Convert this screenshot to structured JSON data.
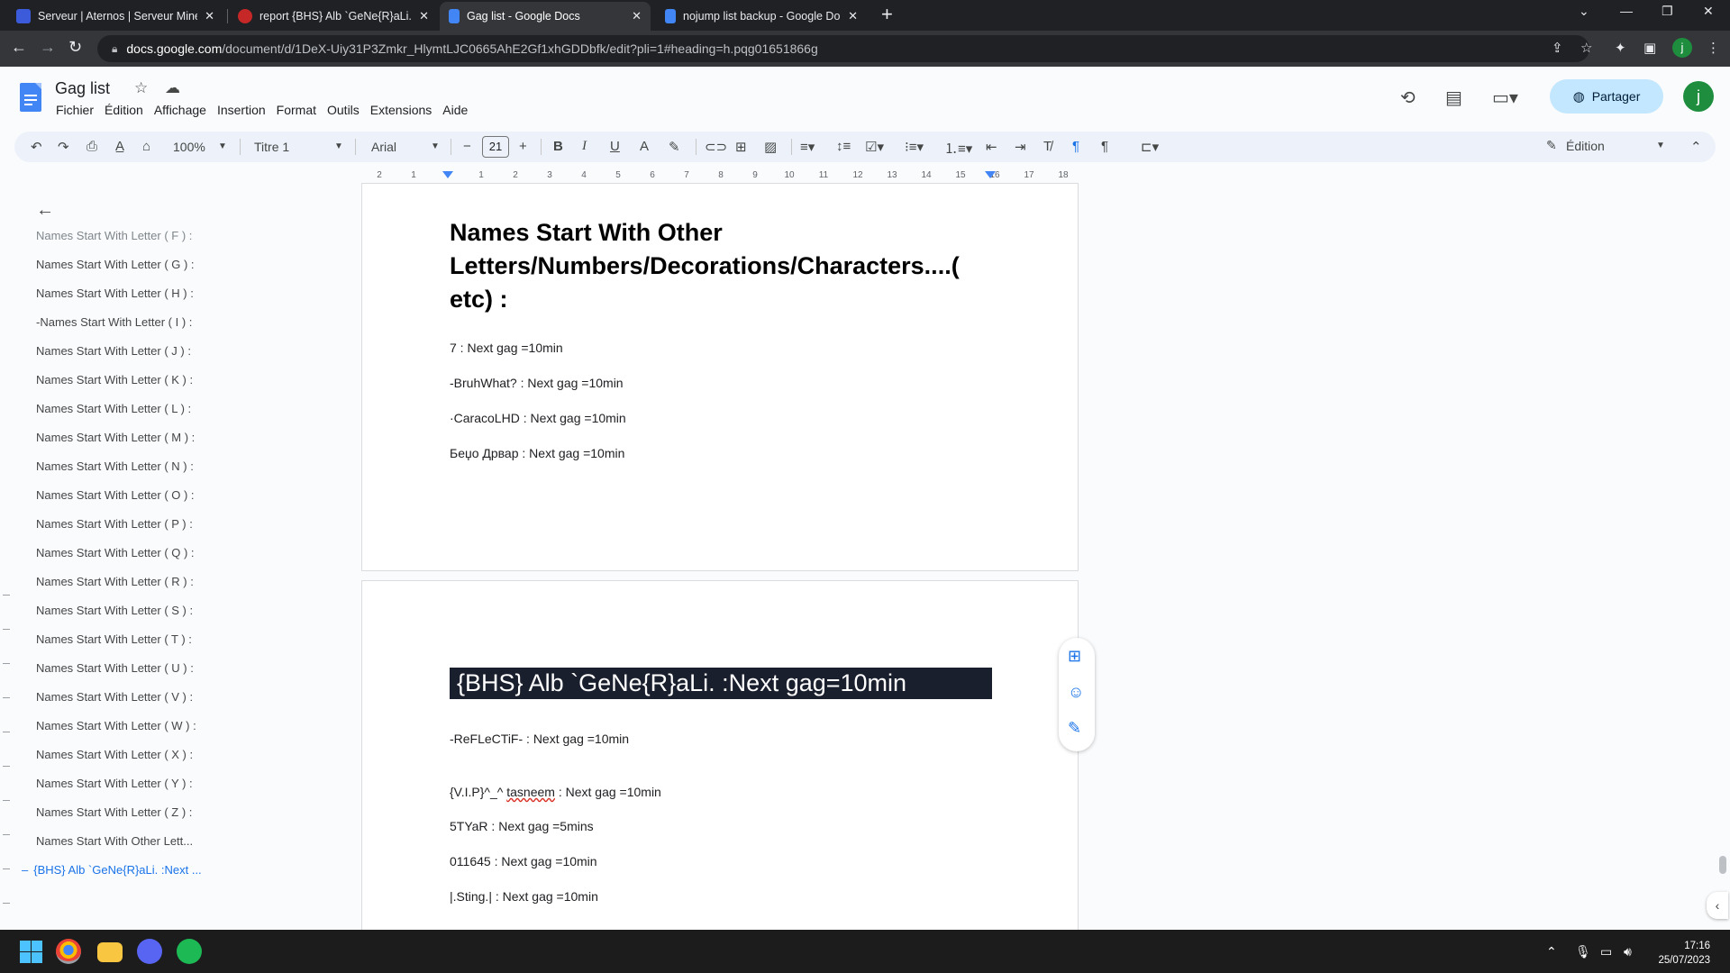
{
  "browser": {
    "tabs": [
      {
        "title": "Serveur | Aternos | Serveur Mine",
        "active": false,
        "icon": "aternos-icon"
      },
      {
        "title": "report {BHS} Alb `GeNe{R}aLi. - P",
        "active": false,
        "icon": "forum-icon"
      },
      {
        "title": "Gag list - Google Docs",
        "active": true,
        "icon": "docs-icon"
      },
      {
        "title": "nojump list backup - Google Do",
        "active": false,
        "icon": "docs-icon"
      }
    ],
    "url_domain": "docs.google.com",
    "url_path": "/document/d/1DeX-Uiy31P3Zmkr_HlymtLJC0665AhE2Gf1xhGDDbfk/edit?pli=1#heading=h.pqg01651866g",
    "profile_initial": "j"
  },
  "docs": {
    "title": "Gag list",
    "menu": [
      "Fichier",
      "Édition",
      "Affichage",
      "Insertion",
      "Format",
      "Outils",
      "Extensions",
      "Aide"
    ],
    "share_label": "Partager",
    "user_initial": "j"
  },
  "toolbar": {
    "zoom": "100%",
    "style": "Titre 1",
    "font": "Arial",
    "font_size": "21",
    "mode": "Édition"
  },
  "ruler": {
    "numbers": [
      "2",
      "1",
      "1",
      "2",
      "3",
      "4",
      "5",
      "6",
      "7",
      "8",
      "9",
      "10",
      "11",
      "12",
      "13",
      "14",
      "15",
      "16",
      "17",
      "18"
    ]
  },
  "outline": {
    "items": [
      "Names Start With Letter ( F ) :",
      "Names Start With Letter ( G ) :",
      "Names Start With Letter ( H ) :",
      "-Names Start With Letter ( I ) :",
      "Names Start With Letter ( J ) :",
      "Names Start With Letter ( K ) :",
      "Names Start With Letter ( L ) :",
      "Names Start With Letter ( M ) :",
      "Names Start With Letter ( N ) :",
      "Names Start With Letter ( O ) :",
      "Names Start With Letter ( P ) :",
      "Names Start With Letter ( Q ) :",
      "Names Start With Letter ( R ) :",
      "Names Start With Letter ( S ) :",
      "Names Start With Letter ( T ) :",
      "Names Start With Letter ( U ) :",
      "Names Start With Letter ( V ) :",
      "Names Start With Letter ( W ) :",
      "Names Start With Letter ( X ) :",
      "Names Start With Letter ( Y ) :",
      "Names Start With Letter ( Z ) :",
      "Names Start With Other Lett...",
      "{BHS} Alb `GeNe{R}aLi. :Next ..."
    ],
    "active_index": 22
  },
  "page1": {
    "heading": "Names Start With Other Letters/Numbers/Decorations/Characters....( etc) :",
    "entries": [
      "7 : Next gag =10min",
      "-BruhWhat? : Next gag =10min",
      "·CaracoLHD : Next gag =10min",
      "Беџо Дрвар : Next gag =10min"
    ]
  },
  "page2": {
    "heading": "{BHS} Alb `GeNe{R}aLi. :Next gag=10min",
    "entries": [
      "-ReFLeCTiF- : Next gag =10min",
      "{V.I.P}^_^ ",
      "tasneem",
      " : Next gag =10min",
      "5TYaR : Next gag =5mins",
      "011645 : Next gag =10min",
      "|.Sting.| : Next gag =10min"
    ]
  },
  "taskbar": {
    "time": "17:16",
    "date": "25/07/2023"
  }
}
